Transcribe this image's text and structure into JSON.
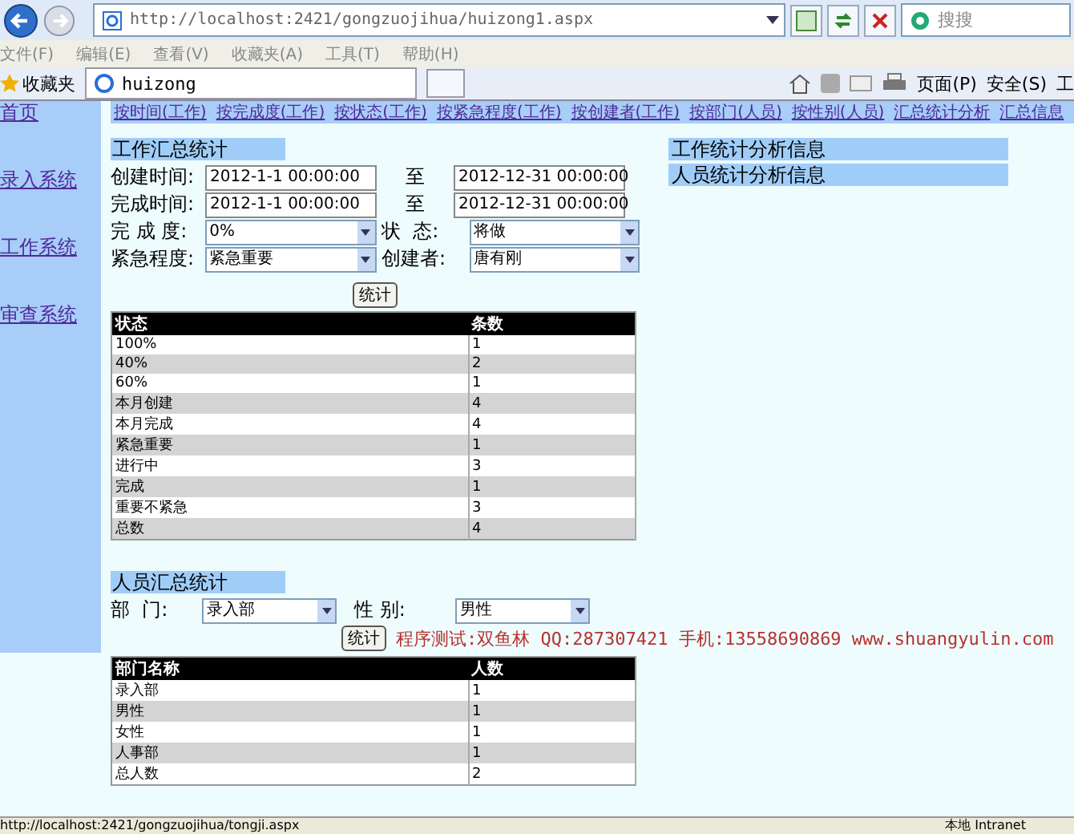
{
  "browser": {
    "address": "http://localhost:2421/gongzuojihua/huizong1.aspx",
    "search_placeholder": "搜搜",
    "menu": [
      "文件(F)",
      "编辑(E)",
      "查看(V)",
      "收藏夹(A)",
      "工具(T)",
      "帮助(H)"
    ],
    "favorites": "收藏夹",
    "tab_title": "huizong",
    "tools": [
      "页面(P)",
      "安全(S)",
      "工"
    ]
  },
  "sidebar": {
    "items": [
      "首页",
      "录入系统",
      "工作系统",
      "审查系统"
    ]
  },
  "top_links": [
    "按时间(工作)",
    "按完成度(工作)",
    "按状态(工作)",
    "按紧急程度(工作)",
    "按创建者(工作)",
    "按部门(人员)",
    "按性别(人员)",
    "汇总统计分析",
    "汇总信息"
  ],
  "work": {
    "title": "工作汇总统计",
    "date_rows": [
      {
        "label": "创建时间:",
        "from": "2012-1-1 00:00:00",
        "sep": "至",
        "to": "2012-12-31 00:00:00"
      },
      {
        "label": "完成时间:",
        "from": "2012-1-1 00:00:00",
        "sep": "至",
        "to": "2012-12-31 00:00:00"
      }
    ],
    "select_rows": [
      {
        "label": "完 成 度:",
        "value": "0%",
        "label2": "状  态:",
        "value2": "将做"
      },
      {
        "label": "紧急程度:",
        "value": "紧急重要",
        "label2": "创建者:",
        "value2": "唐有刚"
      }
    ],
    "button": "统计",
    "table": {
      "columns": [
        "状态",
        "条数"
      ],
      "rows": [
        [
          "100%",
          "1"
        ],
        [
          "40%",
          "2"
        ],
        [
          "60%",
          "1"
        ],
        [
          "本月创建",
          "4"
        ],
        [
          "本月完成",
          "4"
        ],
        [
          "紧急重要",
          "1"
        ],
        [
          "进行中",
          "3"
        ],
        [
          "完成",
          "1"
        ],
        [
          "重要不紧急",
          "3"
        ],
        [
          "总数",
          "4"
        ]
      ]
    }
  },
  "side_links": [
    "工作统计分析信息",
    "人员统计分析信息"
  ],
  "people": {
    "title": "人员汇总统计",
    "dept_label": "部  门:",
    "dept": "录入部",
    "gender_label": "性 别:",
    "gender": "男性",
    "button": "统计",
    "credit": "程序测试:双鱼林 QQ:287307421 手机:13558690869 www.shuangyulin.com",
    "table": {
      "columns": [
        "部门名称",
        "人数"
      ],
      "rows": [
        [
          "录入部",
          "1"
        ],
        [
          "男性",
          "1"
        ],
        [
          "女性",
          "1"
        ],
        [
          "人事部",
          "1"
        ],
        [
          "总人数",
          "2"
        ]
      ]
    }
  },
  "status_bar": {
    "url": "http://localhost:2421/gongzuojihua/tongji.aspx",
    "zone": "本地 Intranet"
  }
}
